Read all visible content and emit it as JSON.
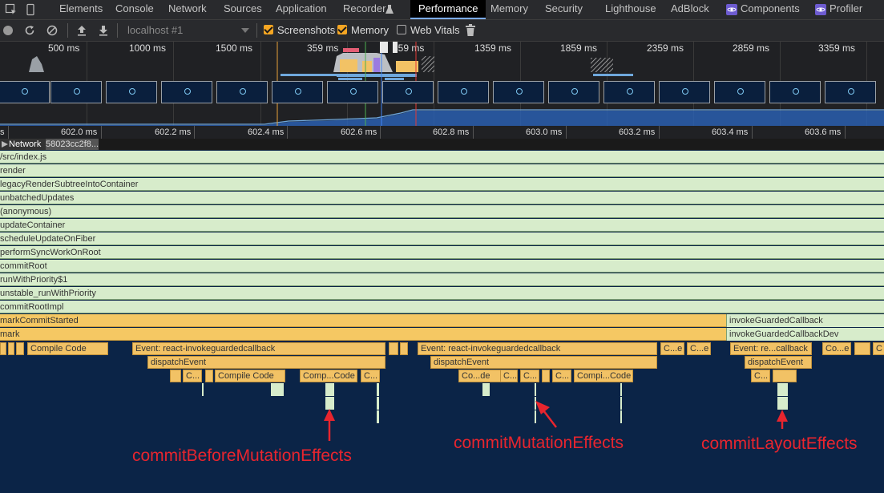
{
  "tabs": {
    "elements": "Elements",
    "console": "Console",
    "network": "Network",
    "sources": "Sources",
    "application": "Application",
    "recorder": "Recorder",
    "performance": "Performance",
    "memory": "Memory",
    "security": "Security",
    "lighthouse": "Lighthouse",
    "adblock": "AdBlock",
    "components": "Components",
    "profiler": "Profiler"
  },
  "toolbar": {
    "target": "localhost #1",
    "screenshots_label": "Screenshots",
    "screenshots_checked": true,
    "memory_label": "Memory",
    "memory_checked": true,
    "webvitals_label": "Web Vitals",
    "webvitals_checked": false
  },
  "overview": {
    "ticks": [
      "500 ms",
      "1000 ms",
      "1500 ms",
      "359 ms",
      "859 ms",
      "1359 ms",
      "1859 ms",
      "2359 ms",
      "2859 ms",
      "3359 ms"
    ]
  },
  "ruler": {
    "ticks": [
      "602.0 ms",
      "602.2 ms",
      "602.4 ms",
      "602.6 ms",
      "602.8 ms",
      "603.0 ms",
      "603.2 ms",
      "603.4 ms",
      "603.6 ms"
    ],
    "left_fragment": "s"
  },
  "network": {
    "label": "Network",
    "url": "58023cc2f8..."
  },
  "flame": {
    "rows": [
      "/src/index.js",
      "render",
      "legacyRenderSubtreeIntoContainer",
      "unbatchedUpdates",
      "(anonymous)",
      "updateContainer",
      "scheduleUpdateOnFiber",
      "performSyncWorkOnRoot",
      "commitRoot",
      "runWithPriority$1",
      "unstable_runWithPriority",
      "commitRootImpl",
      "markCommitStarted",
      "mark"
    ],
    "right_cells": [
      "invokeGuardedCallback",
      "invokeGuardedCallbackDev"
    ],
    "compile_code": "Compile Code",
    "event_full": "Event: react-invokeguardedcallback",
    "event_short": "Event: re...callback",
    "dispatch": "dispatchEvent",
    "c": "C...",
    "ce": "C...e",
    "co": "Co...e",
    "c_bare": "C",
    "comp_code": "Comp...Code",
    "compi_code": "Compi...Code",
    "code_short": "Co...de"
  },
  "annotations": {
    "before": "commitBeforeMutationEffects",
    "mutation": "commitMutationEffects",
    "layout": "commitLayoutEffects"
  },
  "colors": {
    "flame_green": "#d7eccb",
    "flame_yellow": "#f5c863",
    "annotation_red": "#e8252e",
    "background": "#0b2447"
  }
}
